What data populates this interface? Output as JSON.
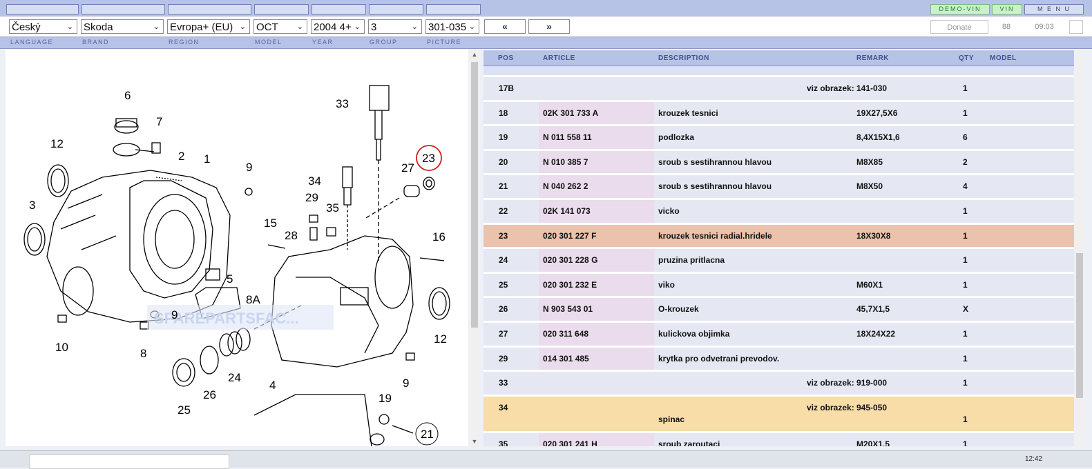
{
  "topbar": {
    "demo_vin": "DEMO-VIN",
    "vin": "VIN",
    "menu": "M E N U"
  },
  "selects": {
    "language": "Český",
    "brand": "Skoda",
    "region": "Evropa+ (EU)",
    "model": "OCT",
    "year": "2004  4+",
    "group": "3",
    "picture": "301-035"
  },
  "nav": {
    "prev": "«",
    "next": "»"
  },
  "status": {
    "donate": "Donate",
    "counter": "88",
    "clock": "09:03"
  },
  "labels": {
    "language": "LANGUAGE",
    "brand": "BRAND",
    "region": "REGION",
    "model": "MODEL",
    "year": "YEAR",
    "group": "GROUP",
    "picture": "PICTURE"
  },
  "table": {
    "headers": {
      "pos": "POS",
      "article": "ARTICLE",
      "description": "DESCRIPTION",
      "remark": "REMARK",
      "qty": "QTY",
      "model": "MODEL"
    },
    "rows": [
      {
        "pos": "17B",
        "article": "",
        "description": "",
        "viz": "viz obrazek:",
        "remark": "141-030",
        "qty": "1"
      },
      {
        "pos": "18",
        "article": "02K 301 733 A",
        "description": "krouzek tesnici",
        "viz": "",
        "remark": "19X27,5X6",
        "qty": "1"
      },
      {
        "pos": "19",
        "article": "N  011 558 11",
        "description": "podlozka",
        "viz": "",
        "remark": "8,4X15X1,6",
        "qty": "6"
      },
      {
        "pos": "20",
        "article": "N  010 385 7",
        "description": "sroub s sestihrannou hlavou",
        "viz": "",
        "remark": "M8X85",
        "qty": "2"
      },
      {
        "pos": "21",
        "article": "N  040 262 2",
        "description": "sroub s sestihrannou hlavou",
        "viz": "",
        "remark": "M8X50",
        "qty": "4"
      },
      {
        "pos": "22",
        "article": "02K 141 073",
        "description": "vicko",
        "viz": "",
        "remark": "",
        "qty": "1"
      },
      {
        "pos": "23",
        "article": "020 301 227 F",
        "description": "krouzek tesnici radial.hridele",
        "viz": "",
        "remark": "18X30X8",
        "qty": "1"
      },
      {
        "pos": "24",
        "article": "020 301 228 G",
        "description": "pruzina pritlacna",
        "viz": "",
        "remark": "",
        "qty": "1"
      },
      {
        "pos": "25",
        "article": "020 301 232 E",
        "description": "viko",
        "viz": "",
        "remark": "M60X1",
        "qty": "1"
      },
      {
        "pos": "26",
        "article": "N  903 543 01",
        "description": "O-krouzek",
        "viz": "",
        "remark": "45,7X1,5",
        "qty": "X"
      },
      {
        "pos": "27",
        "article": "020 311 648",
        "description": "kulickova objimka",
        "viz": "",
        "remark": "18X24X22",
        "qty": "1"
      },
      {
        "pos": "29",
        "article": "014 301 485",
        "description": "krytka pro odvetrani prevodov.",
        "viz": "",
        "remark": "",
        "qty": "1"
      },
      {
        "pos": "33",
        "article": "",
        "description": "",
        "viz": "viz obrazek:",
        "remark": "919-000",
        "qty": "1"
      },
      {
        "pos": "34",
        "article": "",
        "description": "spinac",
        "viz": "viz obrazek:",
        "remark": "945-050",
        "qty": "1"
      },
      {
        "pos": "35",
        "article": "020 301 241 H",
        "description": "sroub zaroutaci",
        "viz": "",
        "remark": "M20X1,5",
        "qty": "1"
      }
    ]
  },
  "diagram": {
    "callouts": [
      "6",
      "7",
      "12",
      "2",
      "1",
      "9",
      "3",
      "5",
      "8A",
      "9",
      "10",
      "8",
      "25",
      "26",
      "24",
      "4",
      "33",
      "23",
      "27",
      "34",
      "29",
      "35",
      "15",
      "28",
      "16",
      "12",
      "9",
      "19",
      "21"
    ],
    "watermark": "SPAREPARTSFAC... "
  },
  "taskbar": {
    "time": "12:42"
  }
}
